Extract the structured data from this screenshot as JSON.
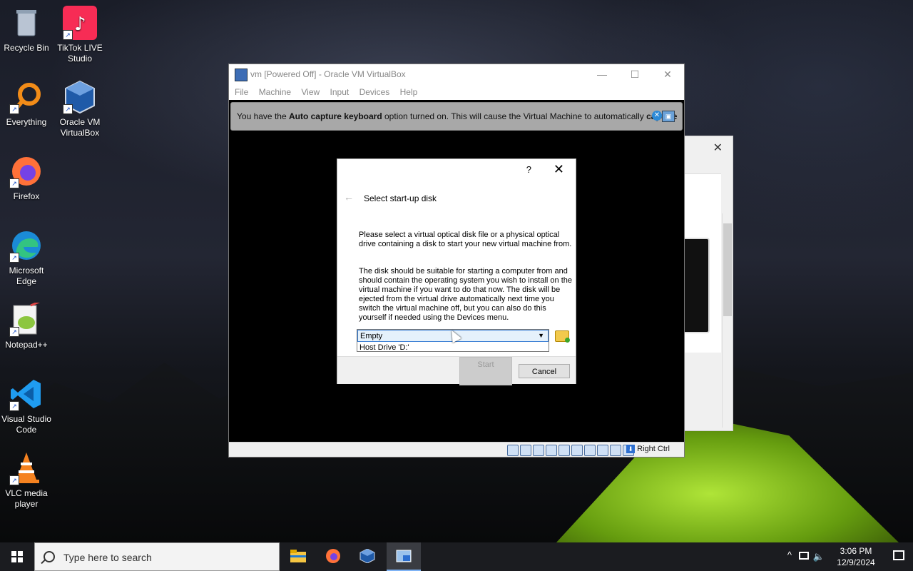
{
  "desktop": {
    "icons": [
      {
        "label": "Recycle Bin"
      },
      {
        "label": "TikTok LIVE Studio"
      },
      {
        "label": "Everything"
      },
      {
        "label": "Oracle VM VirtualBox"
      },
      {
        "label": "Firefox"
      },
      {
        "label": "Microsoft Edge"
      },
      {
        "label": "Notepad++"
      },
      {
        "label": "Visual Studio Code"
      },
      {
        "label": "VLC media player"
      }
    ]
  },
  "vbox": {
    "title": "vm [Powered Off] - Oracle VM VirtualBox",
    "window_buttons": {
      "minimize": "—",
      "maximize": "☐",
      "close": "✕"
    },
    "menu": [
      "File",
      "Machine",
      "View",
      "Input",
      "Devices",
      "Help"
    ],
    "notice": {
      "prefix": "You have the ",
      "bold1": "Auto capture keyboard",
      "middle": " option turned on. This will cause the Virtual Machine to automatically ",
      "bold2": "capture"
    },
    "status": {
      "host_key": "Right Ctrl"
    }
  },
  "dialog": {
    "help": "?",
    "close": "✕",
    "back": "←",
    "title": "Select start-up disk",
    "para1": "Please select a virtual optical disk file or a physical optical drive containing a disk to start your new virtual machine from.",
    "para2": "The disk should be suitable for starting a computer from and should contain the operating system you wish to install on the virtual machine if you want to do that now. The disk will be ejected from the virtual drive automatically next time you switch the virtual machine off, but you can also do this yourself if needed using the Devices menu.",
    "combo": {
      "selected": "Empty",
      "option2": "Host Drive 'D:'"
    },
    "start_label": "Start",
    "cancel_label": "Cancel"
  },
  "taskbar": {
    "search_placeholder": "Type here to search",
    "apps": [
      "file-explorer",
      "firefox",
      "virtualbox",
      "virtualbox-vm"
    ],
    "time": "3:06 PM",
    "date": "12/9/2024"
  },
  "colors": {
    "accent": "#3c7fd4",
    "taskbar": "#1b1c20",
    "notice_bg": "#a8a8a8"
  }
}
